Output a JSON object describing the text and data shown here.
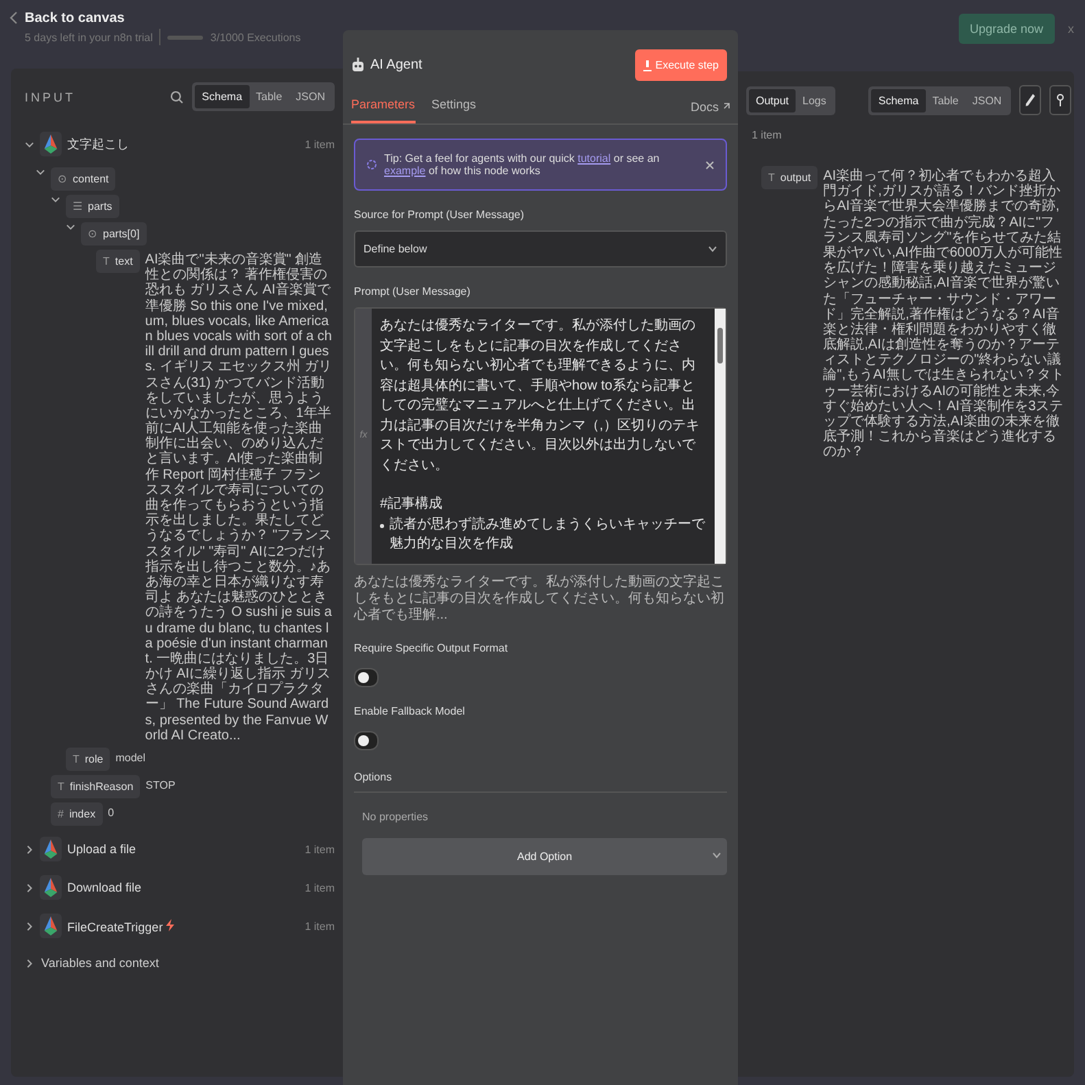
{
  "top_bar": {
    "back": "Back to canvas",
    "trial": "5 days left in your n8n trial",
    "executions_bar": {
      "level": 0.003
    },
    "executions": "3/1000 Executions",
    "upgrade": "Upgrade now",
    "close": "x"
  },
  "input_panel": {
    "title": "INPUT",
    "view_tabs": [
      {
        "label": "Schema",
        "selected": true
      },
      {
        "label": "Table",
        "selected": false
      },
      {
        "label": "JSON",
        "selected": false
      }
    ],
    "nodes": [
      {
        "name": "文字起こし",
        "count": "1 item",
        "expanded": true,
        "trigger": false,
        "fields": [
          {
            "key": "content",
            "type_icon": "⊙",
            "expanded": true,
            "children": [
              {
                "key": "parts",
                "type_icon": "☰",
                "expanded": true,
                "children": [
                  {
                    "key": "parts[0]",
                    "type_icon": "⊙",
                    "expanded": true,
                    "children": [
                      {
                        "key": "text",
                        "type_icon": "T",
                        "value": "AI楽曲で\"未来の音楽賞\" 創造性との関係は？ 著作権侵害の恐れも ガリスさん AI音楽賞で準優勝 So this one I've mixed, um, blues vocals, like American blues vocals with sort of a chill drill and drum pattern I guess. イギリス エセックス州 ガリスさん(31) かつてバンド活動をしていましたが、思うようにいかなかったところ、1年半前にAI人工知能を使った楽曲制作に出会い、のめり込んだと言います。AI使った楽曲制作 Report 岡村佳穂子 フランススタイルで寿司についての曲を作ってもらおうという指示を出しました。果たしてどうなるでしょうか？ \"フランススタイル\" \"寿司\" AIに2つだけ指示を出し待つこと数分。♪ああ海の幸と日本が織りなす寿司よ あなたは魅惑のひとときの詩をうたう O sushi je suis au drame du blanc, tu chantes la poésie d'un instant charmant. 一晩曲にはなりました。3日かけ AIに繰り返し指示 ガリスさんの楽曲「カイロプラクター」 The Future Sound Awards, presented by the Fanvue World AI Creato..."
                      }
                    ]
                  }
                ]
              },
              {
                "key": "role",
                "type_icon": "T",
                "value": "model"
              }
            ]
          },
          {
            "key": "finishReason",
            "type_icon": "T",
            "value": "STOP"
          },
          {
            "key": "index",
            "type_icon": "#",
            "value": "0"
          }
        ]
      },
      {
        "name": "Upload a file",
        "count": "1 item",
        "expanded": false,
        "trigger": false
      },
      {
        "name": "Download file",
        "count": "1 item",
        "expanded": false,
        "trigger": false
      },
      {
        "name": "FileCreateTrigger",
        "count": "1 item",
        "expanded": false,
        "trigger": true
      }
    ],
    "variables": "Variables and context"
  },
  "node_panel": {
    "title": "AI Agent",
    "execute": "Execute step",
    "tabs": [
      {
        "label": "Parameters",
        "selected": true
      },
      {
        "label": "Settings",
        "selected": false
      }
    ],
    "docs": "Docs",
    "tip": {
      "lead": "Tip: Get a feel for agents with our quick",
      "link_1": "tutorial",
      "middle": "or see an",
      "link_2": "example",
      "end": "of how this node works"
    },
    "source_label": "Source for Prompt (User Message)",
    "source_value": "Define below",
    "prompt_label": "Prompt (User Message)",
    "prompt_badge": "fx",
    "prompt": [
      {
        "kind": "paragraph",
        "text": "あなたは優秀なライターです。私が添付した動画の文字起こしをもとに記事の目次を作成してください。何も知らない初心者でも理解できるように、内容は超具体的に書いて、手順やhow to系なら記事としての完璧なマニュアルへと仕上げてください。出力は記事の目次だけを半角カンマ（,）区切りのテキストで出力してください。目次以外は出力しないでください。"
      },
      {
        "kind": "heading",
        "text": "#記事構成"
      },
      {
        "kind": "bullet",
        "text": "読者が思わず読み進めてしまうくらいキャッチーで魅力的な目次を作成"
      }
    ],
    "prompt_preview": "あなたは優秀なライターです。私が添付した動画の文字起こしをもとに記事の目次を作成してください。何も知らない初心者でも理解...",
    "switches": [
      {
        "label": "Require Specific Output Format",
        "on": false
      },
      {
        "label": "Enable Fallback Model",
        "on": false
      }
    ],
    "options_title": "Options",
    "options_empty": "No properties",
    "add_option": "Add Option"
  },
  "output_panel": {
    "tabs": [
      {
        "label": "Output",
        "selected": true
      },
      {
        "label": "Logs",
        "selected": false
      }
    ],
    "view_tabs": [
      {
        "label": "Schema",
        "selected": true
      },
      {
        "label": "Table",
        "selected": false
      },
      {
        "label": "JSON",
        "selected": false
      }
    ],
    "count": "1 item",
    "fields": [
      {
        "key": "output",
        "type_icon": "T",
        "value": "AI楽曲って何？初心者でもわかる超入門ガイド,ガリスが語る！バンド挫折からAI音楽で世界大会準優勝までの奇跡,たった2つの指示で曲が完成？AIに\"フランス風寿司ソング\"を作らせてみた結果がヤバい,AI作曲で6000万人が可能性を広げた！障害を乗り越えたミュージシャンの感動秘話,AI音楽で世界が驚いた「フューチャー・サウンド・アワード」完全解説,著作権はどうなる？AI音楽と法律・権利問題をわかりやすく徹底解説,AIは創造性を奪うのか？アーティストとテクノロジーの\"終わらない議論\",もうAI無しでは生きられない？タトゥー芸術におけるAIの可能性と未来,今すぐ始めたい人へ！AI音楽制作を3ステップで体験する方法,AI楽曲の未来を徹底予測！これから音楽はどう進化するのか？"
      }
    ]
  }
}
